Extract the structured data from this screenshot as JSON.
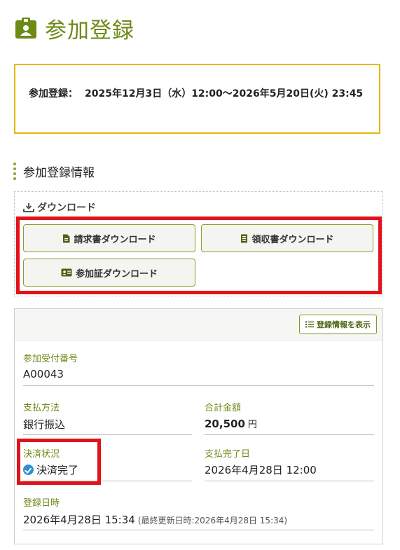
{
  "page": {
    "title": "参加登録"
  },
  "period": {
    "label": "参加登録：",
    "value": "2025年12月3日（水）12:00〜2026年5月20日(火) 23:45"
  },
  "section": {
    "title": "参加登録情報"
  },
  "download": {
    "heading": "ダウンロード",
    "buttons": {
      "invoice": "請求書ダウンロード",
      "receipt": "領収書ダウンロード",
      "certificate": "参加証ダウンロード"
    }
  },
  "info": {
    "show_button": "登録情報を表示",
    "reception_number": {
      "label": "参加受付番号",
      "value": "A00043"
    },
    "payment_method": {
      "label": "支払方法",
      "value": "銀行振込"
    },
    "total_amount": {
      "label": "合計金額",
      "value": "20,500",
      "unit": "円"
    },
    "payment_status": {
      "label": "決済状況",
      "value": "決済完了"
    },
    "payment_completed": {
      "label": "支払完了日",
      "value": "2026年4月28日 12:00"
    },
    "registered_at": {
      "label": "登録日時",
      "value": "2026年4月28日 15:34",
      "note": "(最終更新日時:2026年4月28日 15:34)"
    }
  },
  "colors": {
    "accent": "#6c8a16",
    "highlight_border": "#e4b800",
    "annotation_red": "#e0131b",
    "status_blue": "#2e8fd4"
  },
  "icons": {
    "title": "id-badge-icon",
    "download": "download-icon",
    "invoice": "document-icon",
    "receipt": "receipt-icon",
    "certificate": "id-card-icon",
    "show": "list-icon",
    "status": "check-circle-icon"
  }
}
